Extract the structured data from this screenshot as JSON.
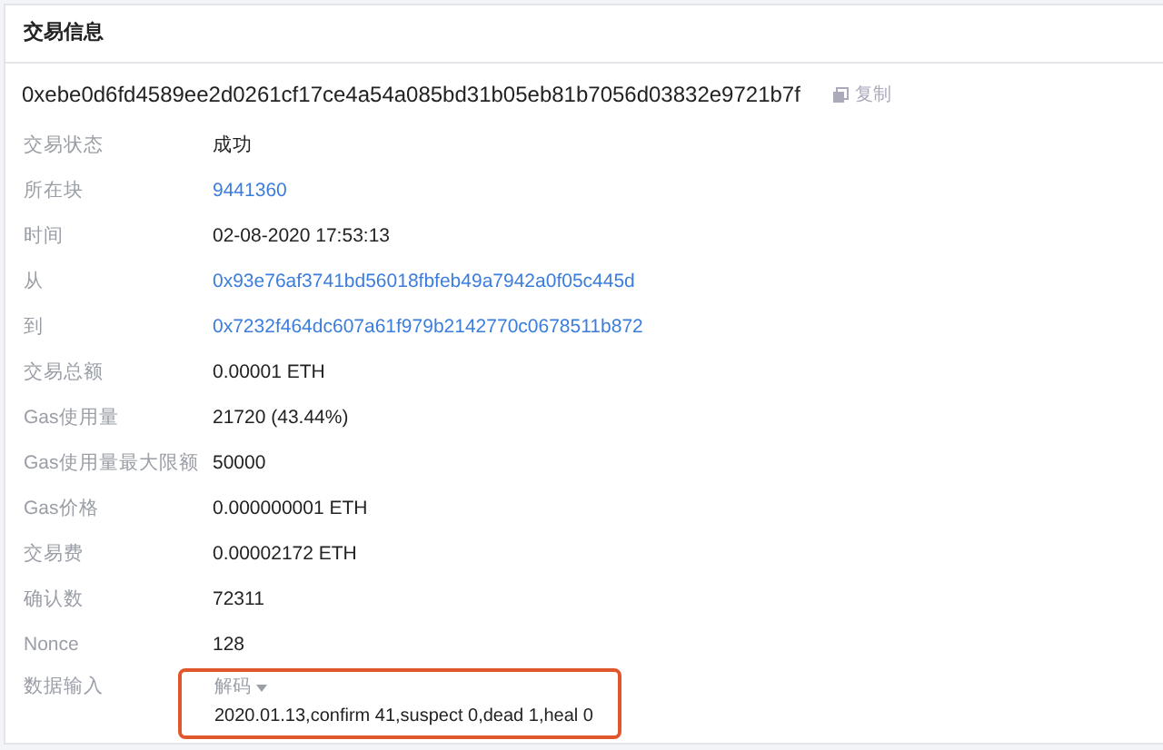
{
  "panel": {
    "title": "交易信息"
  },
  "hash": {
    "value": "0xebe0d6fd4589ee2d0261cf17ce4a54a085bd31b05eb81b7056d03832e9721b7f",
    "copy_label": "复制"
  },
  "fields": [
    {
      "label": "交易状态",
      "value": "成功",
      "kind": "text"
    },
    {
      "label": "所在块",
      "value": "9441360",
      "kind": "link"
    },
    {
      "label": "时间",
      "value": "02-08-2020 17:53:13",
      "kind": "text"
    },
    {
      "label": "从",
      "value": "0x93e76af3741bd56018fbfeb49a7942a0f05c445d",
      "kind": "link"
    },
    {
      "label": "到",
      "value": "0x7232f464dc607a61f979b2142770c0678511b872",
      "kind": "link"
    },
    {
      "label": "交易总额",
      "value": "0.00001 ETH",
      "kind": "text"
    },
    {
      "label": "Gas使用量",
      "value": "21720 (43.44%)",
      "kind": "text"
    },
    {
      "label": "Gas使用量最大限额",
      "value": "50000",
      "kind": "text"
    },
    {
      "label": "Gas价格",
      "value": "0.000000001 ETH",
      "kind": "text"
    },
    {
      "label": "交易费",
      "value": "0.00002172 ETH",
      "kind": "text"
    },
    {
      "label": "确认数",
      "value": "72311",
      "kind": "text"
    },
    {
      "label": "Nonce",
      "value": "128",
      "kind": "text"
    }
  ],
  "data_input": {
    "label": "数据输入",
    "decode_label": "解码",
    "decoded": "2020.01.13,confirm 41,suspect 0,dead 1,heal 0",
    "highlighted": true
  }
}
